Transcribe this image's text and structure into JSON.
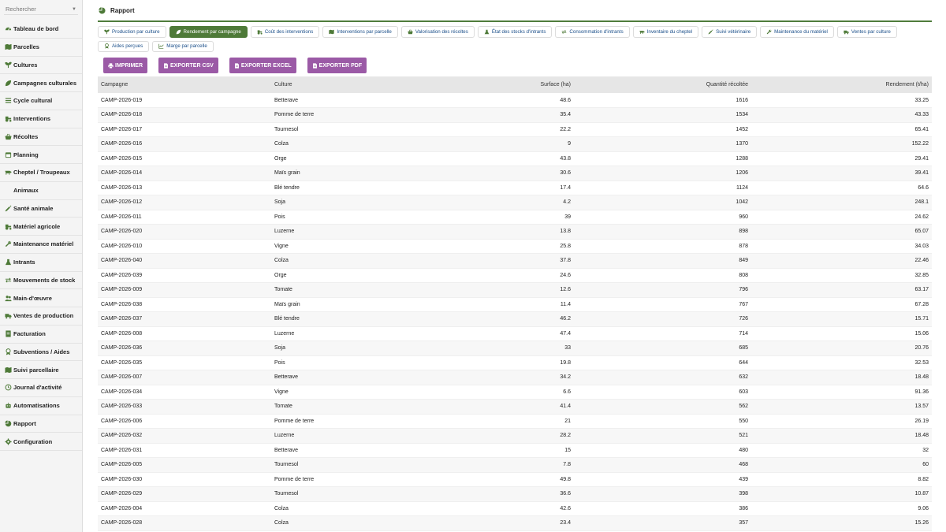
{
  "search": {
    "placeholder": "Rechercher"
  },
  "sidebar": {
    "items": [
      {
        "label": "Tableau de bord",
        "icon": "dashboard-icon"
      },
      {
        "label": "Parcelles",
        "icon": "map-icon"
      },
      {
        "label": "Cultures",
        "icon": "seedling-icon"
      },
      {
        "label": "Campagnes culturales",
        "icon": "leaf-icon"
      },
      {
        "label": "Cycle cultural",
        "icon": "list-icon"
      },
      {
        "label": "Interventions",
        "icon": "tractor-icon"
      },
      {
        "label": "Récoltes",
        "icon": "basket-icon"
      },
      {
        "label": "Planning",
        "icon": "calendar-icon"
      },
      {
        "label": "Cheptel / Troupeaux",
        "icon": "cow-icon"
      },
      {
        "label": "Animaux",
        "icon": ""
      },
      {
        "label": "Santé animale",
        "icon": "syringe-icon"
      },
      {
        "label": "Matériel agricole",
        "icon": "tractor-icon"
      },
      {
        "label": "Maintenance matériel",
        "icon": "wrench-icon"
      },
      {
        "label": "Intrants",
        "icon": "flask-icon"
      },
      {
        "label": "Mouvements de stock",
        "icon": "exchange-icon"
      },
      {
        "label": "Main-d'œuvre",
        "icon": "users-icon"
      },
      {
        "label": "Ventes de production",
        "icon": "truck-icon"
      },
      {
        "label": "Facturation",
        "icon": "invoice-icon"
      },
      {
        "label": "Subventions / Aides",
        "icon": "award-icon"
      },
      {
        "label": "Suivi parcellaire",
        "icon": "map-icon"
      },
      {
        "label": "Journal d'activité",
        "icon": "history-icon"
      },
      {
        "label": "Automatisations",
        "icon": "robot-icon"
      },
      {
        "label": "Rapport",
        "icon": "chart-pie-icon"
      },
      {
        "label": "Configuration",
        "icon": "gear-icon"
      }
    ]
  },
  "header": {
    "title": "Rapport"
  },
  "tabs": [
    {
      "label": "Production par culture",
      "icon": "seedling-icon",
      "active": false
    },
    {
      "label": "Rendement par campagne",
      "icon": "leaf-icon",
      "active": true
    },
    {
      "label": "Coût des interventions",
      "icon": "tractor-icon",
      "active": false
    },
    {
      "label": "Interventions par parcelle",
      "icon": "map-icon",
      "active": false
    },
    {
      "label": "Valorisation des récoltes",
      "icon": "basket-icon",
      "active": false
    },
    {
      "label": "État des stocks d'intrants",
      "icon": "flask-icon",
      "active": false
    },
    {
      "label": "Consommation d'intrants",
      "icon": "exchange-icon",
      "active": false
    },
    {
      "label": "Inventaire du cheptel",
      "icon": "cow-icon",
      "active": false
    },
    {
      "label": "Suivi vétérinaire",
      "icon": "syringe-icon",
      "active": false
    },
    {
      "label": "Maintenance du matériel",
      "icon": "wrench-icon",
      "active": false
    },
    {
      "label": "Ventes par culture",
      "icon": "truck-icon",
      "active": false
    },
    {
      "label": "Aides perçues",
      "icon": "award-icon",
      "active": false
    },
    {
      "label": "Marge par parcelle",
      "icon": "chart-line-icon",
      "active": false
    }
  ],
  "actions": [
    {
      "label": "IMPRIMER",
      "icon": "print-icon"
    },
    {
      "label": "EXPORTER CSV",
      "icon": "file-icon"
    },
    {
      "label": "EXPORTER EXCEL",
      "icon": "file-icon"
    },
    {
      "label": "EXPORTER PDF",
      "icon": "file-icon"
    }
  ],
  "table": {
    "columns": [
      "Campagne",
      "Culture",
      "Surface (ha)",
      "Quantité récoltée",
      "Rendement (t/ha)"
    ],
    "rows": [
      [
        "CAMP-2026-019",
        "Betterave",
        "48.6",
        "1616",
        "33.25"
      ],
      [
        "CAMP-2026-018",
        "Pomme de terre",
        "35.4",
        "1534",
        "43.33"
      ],
      [
        "CAMP-2026-017",
        "Tournesol",
        "22.2",
        "1452",
        "65.41"
      ],
      [
        "CAMP-2026-016",
        "Colza",
        "9",
        "1370",
        "152.22"
      ],
      [
        "CAMP-2026-015",
        "Orge",
        "43.8",
        "1288",
        "29.41"
      ],
      [
        "CAMP-2026-014",
        "Maïs grain",
        "30.6",
        "1206",
        "39.41"
      ],
      [
        "CAMP-2026-013",
        "Blé tendre",
        "17.4",
        "1124",
        "64.6"
      ],
      [
        "CAMP-2026-012",
        "Soja",
        "4.2",
        "1042",
        "248.1"
      ],
      [
        "CAMP-2026-011",
        "Pois",
        "39",
        "960",
        "24.62"
      ],
      [
        "CAMP-2026-020",
        "Luzerne",
        "13.8",
        "898",
        "65.07"
      ],
      [
        "CAMP-2026-010",
        "Vigne",
        "25.8",
        "878",
        "34.03"
      ],
      [
        "CAMP-2026-040",
        "Colza",
        "37.8",
        "849",
        "22.46"
      ],
      [
        "CAMP-2026-039",
        "Orge",
        "24.6",
        "808",
        "32.85"
      ],
      [
        "CAMP-2026-009",
        "Tomate",
        "12.6",
        "796",
        "63.17"
      ],
      [
        "CAMP-2026-038",
        "Maïs grain",
        "11.4",
        "767",
        "67.28"
      ],
      [
        "CAMP-2026-037",
        "Blé tendre",
        "46.2",
        "726",
        "15.71"
      ],
      [
        "CAMP-2026-008",
        "Luzerne",
        "47.4",
        "714",
        "15.06"
      ],
      [
        "CAMP-2026-036",
        "Soja",
        "33",
        "685",
        "20.76"
      ],
      [
        "CAMP-2026-035",
        "Pois",
        "19.8",
        "644",
        "32.53"
      ],
      [
        "CAMP-2026-007",
        "Betterave",
        "34.2",
        "632",
        "18.48"
      ],
      [
        "CAMP-2026-034",
        "Vigne",
        "6.6",
        "603",
        "91.36"
      ],
      [
        "CAMP-2026-033",
        "Tomate",
        "41.4",
        "562",
        "13.57"
      ],
      [
        "CAMP-2026-006",
        "Pomme de terre",
        "21",
        "550",
        "26.19"
      ],
      [
        "CAMP-2026-032",
        "Luzerne",
        "28.2",
        "521",
        "18.48"
      ],
      [
        "CAMP-2026-031",
        "Betterave",
        "15",
        "480",
        "32"
      ],
      [
        "CAMP-2026-005",
        "Tournesol",
        "7.8",
        "468",
        "60"
      ],
      [
        "CAMP-2026-030",
        "Pomme de terre",
        "49.8",
        "439",
        "8.82"
      ],
      [
        "CAMP-2026-029",
        "Tournesol",
        "36.6",
        "398",
        "10.87"
      ],
      [
        "CAMP-2026-004",
        "Colza",
        "42.6",
        "386",
        "9.06"
      ],
      [
        "CAMP-2026-028",
        "Colza",
        "23.4",
        "357",
        "15.26"
      ]
    ]
  },
  "colors": {
    "accent": "#4e7a38",
    "button": "#9b5aa6",
    "link": "#1b4f8a"
  }
}
